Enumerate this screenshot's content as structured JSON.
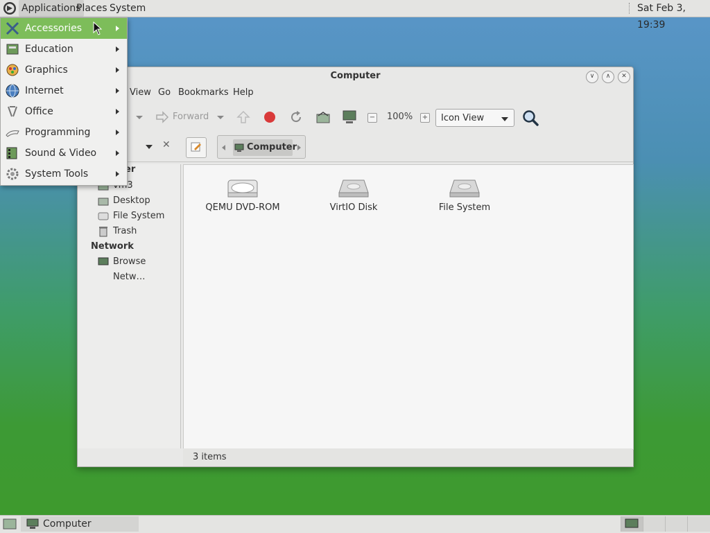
{
  "top_panel": {
    "menus": [
      "Applications",
      "Places",
      "System"
    ],
    "clock": "Sat Feb  3, 19:39"
  },
  "apps_menu": {
    "items": [
      {
        "label": "Accessories",
        "icon": "accessories-icon",
        "active": true
      },
      {
        "label": "Education",
        "icon": "education-icon"
      },
      {
        "label": "Graphics",
        "icon": "graphics-icon"
      },
      {
        "label": "Internet",
        "icon": "internet-icon"
      },
      {
        "label": "Office",
        "icon": "office-icon"
      },
      {
        "label": "Programming",
        "icon": "programming-icon"
      },
      {
        "label": "Sound & Video",
        "icon": "sound-video-icon"
      },
      {
        "label": "System Tools",
        "icon": "system-tools-icon"
      }
    ]
  },
  "window": {
    "title": "Computer",
    "menubar": [
      "View",
      "Go",
      "Bookmarks",
      "Help"
    ],
    "toolbar": {
      "forward": "Forward",
      "zoom": "100%",
      "view_mode": "Icon View"
    },
    "location": {
      "current": "Computer"
    },
    "sidebar": {
      "partial_header": "er",
      "places": [
        "vm3",
        "Desktop",
        "File System",
        "Trash"
      ],
      "network_header": "Network",
      "network": [
        "Browse Netw…"
      ]
    },
    "items": [
      {
        "label": "QEMU DVD-ROM",
        "icon": "optical-drive-icon"
      },
      {
        "label": "VirtIO Disk",
        "icon": "hard-disk-icon"
      },
      {
        "label": "File System",
        "icon": "hard-disk-icon"
      }
    ],
    "status": "3 items"
  },
  "bottom_panel": {
    "task": "Computer"
  },
  "colors": {
    "menu_highlight": "#7dbd5a"
  }
}
